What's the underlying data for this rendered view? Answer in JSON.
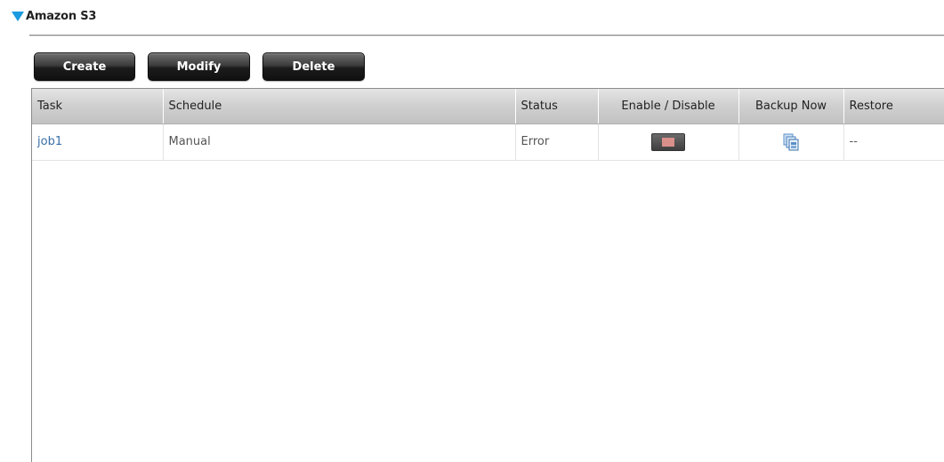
{
  "section": {
    "title": "Amazon S3"
  },
  "toolbar": {
    "create_label": "Create",
    "modify_label": "Modify",
    "delete_label": "Delete"
  },
  "table": {
    "columns": [
      "Task",
      "Schedule",
      "Status",
      "Enable / Disable",
      "Backup Now",
      "Restore"
    ],
    "rows": [
      {
        "task": "job1",
        "schedule": "Manual",
        "status": "Error",
        "enabled": false,
        "backup_icon": "backup-copy-icon",
        "restore": "--"
      }
    ]
  },
  "colors": {
    "accent": "#1a9ae0",
    "task_link": "#3a6fa8",
    "toggle_off": "#d9908a"
  }
}
